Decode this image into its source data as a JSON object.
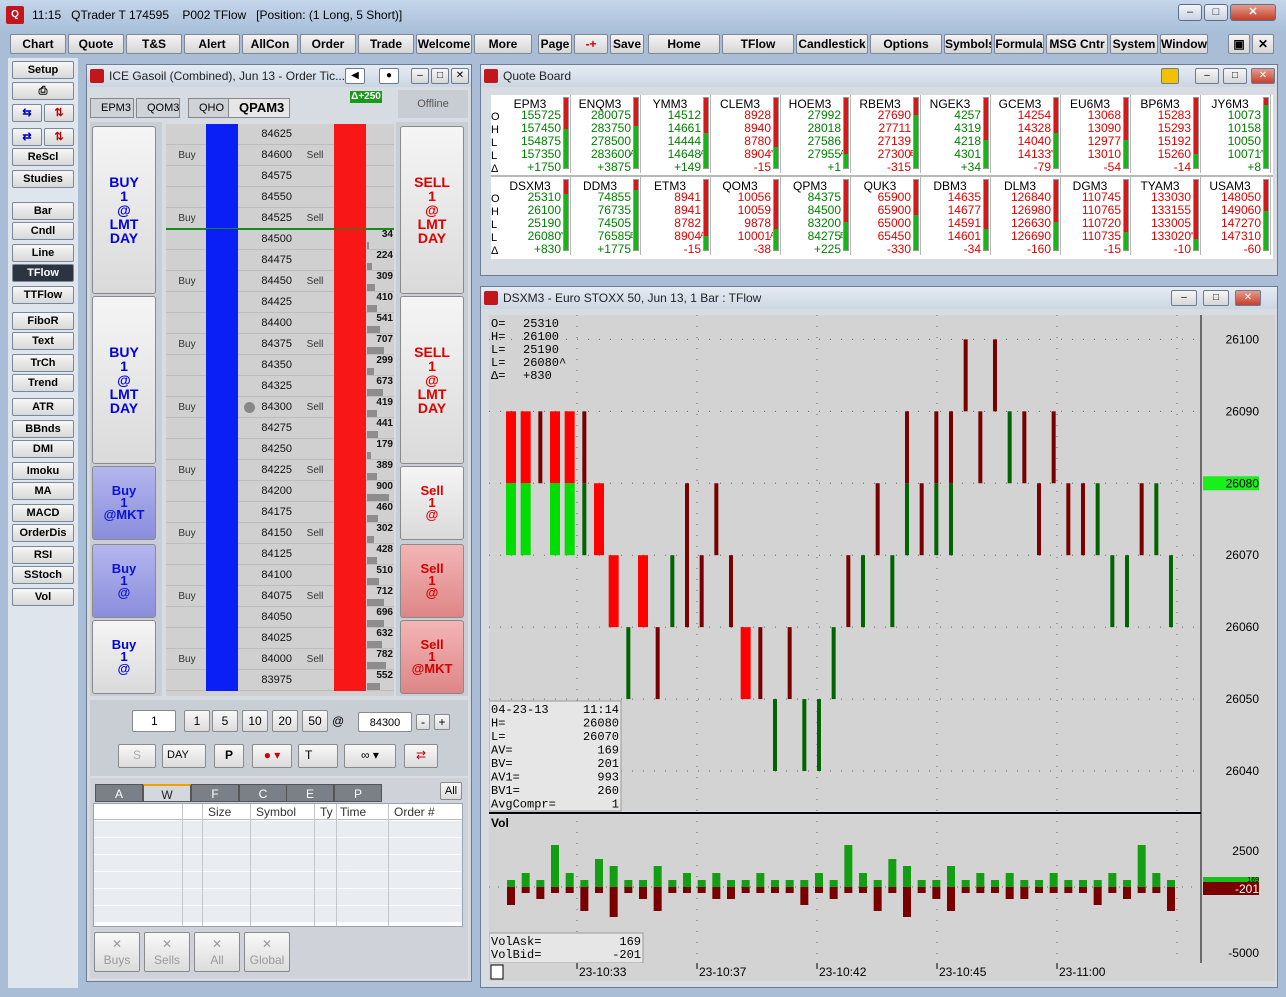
{
  "window": {
    "icon": "qtrader-logo",
    "time": "11:15",
    "title": "QTrader T 174595",
    "page": "P002 TFlow",
    "position": "[Position: (1 Long, 5 Short)]"
  },
  "toolbar": [
    "Chart",
    "Quote",
    "T&S",
    "Alert",
    "AllCon",
    "Order",
    "Trade",
    "Welcome",
    "More",
    "Page",
    "-+",
    "Save",
    "Home",
    "TFlow",
    "Candlestick",
    "Options",
    "Symbols",
    "Formula",
    "MSG Cntr",
    "System",
    "Window"
  ],
  "left_tools": [
    "Setup",
    "ReScl",
    "Studies",
    "Bar",
    "Cndl",
    "Line",
    "TFlow",
    "TTFlow",
    "FiboR",
    "Text",
    "TrCh",
    "Trend",
    "ATR",
    "BBnds",
    "DMI",
    "Imoku",
    "MA",
    "MACD",
    "OrderDis",
    "RSI",
    "SStoch",
    "Vol"
  ],
  "ticket": {
    "title": "ICE Gasoil (Combined), Jun 13 - Order Tic...",
    "tabs": [
      "EPM3",
      "QOM3",
      "QHO",
      "QPAM3"
    ],
    "delta": "Δ+250",
    "status": "Offline",
    "buy_buttons": [
      [
        "BUY",
        "1",
        "@",
        "LMT",
        "DAY"
      ],
      [
        "BUY",
        "1",
        "@",
        "LMT",
        "DAY"
      ],
      [
        "Buy",
        "1",
        "@MKT"
      ],
      [
        "Buy",
        "1",
        "@"
      ],
      [
        "Buy",
        "1",
        "@"
      ]
    ],
    "sell_buttons": [
      [
        "SELL",
        "1",
        "@",
        "LMT",
        "DAY"
      ],
      [
        "SELL",
        "1",
        "@",
        "LMT",
        "DAY"
      ],
      [
        "Sell",
        "1",
        "@"
      ],
      [
        "Sell",
        "1",
        "@"
      ],
      [
        "Sell",
        "1",
        "@MKT"
      ]
    ],
    "ladder": [
      {
        "price": "84625",
        "buy": "",
        "sell": "",
        "vol": ""
      },
      {
        "price": "84600",
        "buy": "Buy",
        "sell": "Sell",
        "vol": ""
      },
      {
        "price": "84575",
        "buy": "",
        "sell": "",
        "vol": ""
      },
      {
        "price": "84550",
        "buy": "",
        "sell": "",
        "vol": ""
      },
      {
        "price": "84525",
        "buy": "Buy",
        "sell": "Sell",
        "vol": ""
      },
      {
        "price": "84500",
        "buy": "",
        "sell": "",
        "vol": "34"
      },
      {
        "price": "84475",
        "buy": "",
        "sell": "",
        "vol": "224"
      },
      {
        "price": "84450",
        "buy": "Buy",
        "sell": "Sell",
        "vol": "309"
      },
      {
        "price": "84425",
        "buy": "",
        "sell": "",
        "vol": "410"
      },
      {
        "price": "84400",
        "buy": "",
        "sell": "",
        "vol": "541"
      },
      {
        "price": "84375",
        "buy": "Buy",
        "sell": "Sell",
        "vol": "707"
      },
      {
        "price": "84350",
        "buy": "",
        "sell": "",
        "vol": "299"
      },
      {
        "price": "84325",
        "buy": "",
        "sell": "",
        "vol": "673"
      },
      {
        "price": "84300",
        "buy": "Buy",
        "sell": "Sell",
        "vol": "419"
      },
      {
        "price": "84275",
        "buy": "",
        "sell": "",
        "vol": "441"
      },
      {
        "price": "84250",
        "buy": "",
        "sell": "",
        "vol": "179"
      },
      {
        "price": "84225",
        "buy": "Buy",
        "sell": "Sell",
        "vol": "389"
      },
      {
        "price": "84200",
        "buy": "",
        "sell": "",
        "vol": "900"
      },
      {
        "price": "84175",
        "buy": "",
        "sell": "",
        "vol": "460"
      },
      {
        "price": "84150",
        "buy": "Buy",
        "sell": "Sell",
        "vol": "302"
      },
      {
        "price": "84125",
        "buy": "",
        "sell": "",
        "vol": "428"
      },
      {
        "price": "84100",
        "buy": "",
        "sell": "",
        "vol": "510"
      },
      {
        "price": "84075",
        "buy": "Buy",
        "sell": "Sell",
        "vol": "712"
      },
      {
        "price": "84050",
        "buy": "",
        "sell": "",
        "vol": "696"
      },
      {
        "price": "84025",
        "buy": "",
        "sell": "",
        "vol": "632"
      },
      {
        "price": "84000",
        "buy": "Buy",
        "sell": "Sell",
        "vol": "782"
      },
      {
        "price": "83975",
        "buy": "",
        "sell": "",
        "vol": "552"
      }
    ],
    "qty": "1",
    "qty_presets": [
      "1",
      "5",
      "10",
      "20",
      "50"
    ],
    "at": "@",
    "price": "84300",
    "tif": "DAY",
    "type_t": "T",
    "grid_tabs": [
      "A",
      "W",
      "F",
      "C",
      "E",
      "P"
    ],
    "grid_all": "All",
    "grid_headers": [
      "Size",
      "Symbol",
      "Ty",
      "Time",
      "Order #"
    ],
    "cancel_buttons": [
      "Buys",
      "Sells",
      "All",
      "Global"
    ]
  },
  "quote_board": {
    "title": "Quote Board",
    "rows": [
      [
        {
          "sym": "EPM3",
          "o": "155725",
          "h": "157450",
          "l": "154875",
          "last": "157350",
          "d": "+1750",
          "color": "green",
          "tick": "",
          "fill": 0.55
        },
        {
          "sym": "ENQM3",
          "o": "280075",
          "h": "283750",
          "l": "278500",
          "last": "283600",
          "d": "+3875",
          "color": "green",
          "tick": "A",
          "fill": 0.6
        },
        {
          "sym": "YMM3",
          "o": "14512",
          "h": "14661",
          "l": "14444",
          "last": "14648",
          "d": "+149",
          "color": "green",
          "tick": "A",
          "fill": 0.5
        },
        {
          "sym": "CLEM3",
          "o": "8928",
          "h": "8940",
          "l": "8780",
          "last": "8904",
          "d": "-15",
          "color": "red",
          "tick": "^",
          "fill": 0.3
        },
        {
          "sym": "HOEM3",
          "o": "27992",
          "h": "28018",
          "l": "27586",
          "last": "27955",
          "d": "+1",
          "color": "green",
          "tick": "A",
          "fill": 0.2
        },
        {
          "sym": "RBEM3",
          "o": "27690",
          "h": "27711",
          "l": "27139",
          "last": "27300",
          "d": "-315",
          "color": "red",
          "tick": "B",
          "fill": 0.75
        },
        {
          "sym": "NGEK3",
          "o": "4257",
          "h": "4319",
          "l": "4218",
          "last": "4301",
          "d": "+34",
          "color": "green",
          "tick": "",
          "fill": 0.4
        },
        {
          "sym": "GCEM3",
          "o": "14254",
          "h": "14328",
          "l": "14040",
          "last": "14133",
          "d": "-79",
          "color": "red",
          "tick": "^",
          "fill": 0.5
        },
        {
          "sym": "EU6M3",
          "o": "13068",
          "h": "13090",
          "l": "12977",
          "last": "13010",
          "d": "-54",
          "color": "red",
          "tick": "",
          "fill": 0.4
        },
        {
          "sym": "BP6M3",
          "o": "15283",
          "h": "15293",
          "l": "15192",
          "last": "15260",
          "d": "-14",
          "color": "red",
          "tick": "",
          "fill": 0.2
        },
        {
          "sym": "JY6M3",
          "o": "10073",
          "h": "10158",
          "l": "10050",
          "last": "10071",
          "d": "+8",
          "color": "green",
          "tick": "^",
          "fill": 0.9
        }
      ],
      [
        {
          "sym": "DSXM3",
          "o": "25310",
          "h": "26100",
          "l": "25190",
          "last": "26080",
          "d": "+830",
          "color": "green",
          "tick": "^",
          "fill": 0.8
        },
        {
          "sym": "DDM3",
          "o": "74855",
          "h": "76735",
          "l": "74505",
          "last": "76585",
          "d": "+1775",
          "color": "green",
          "tick": "B",
          "fill": 0.85
        },
        {
          "sym": "ETM3",
          "o": "8941",
          "h": "8941",
          "l": "8782",
          "last": "8904",
          "d": "-15",
          "color": "red",
          "tick": "A",
          "fill": 0.2
        },
        {
          "sym": "QOM3",
          "o": "10056",
          "h": "10059",
          "l": "9878",
          "last": "10001",
          "d": "-38",
          "color": "red",
          "tick": "A",
          "fill": 0.3
        },
        {
          "sym": "QPM3",
          "o": "84375",
          "h": "84500",
          "l": "83200",
          "last": "84275",
          "d": "+225",
          "color": "green",
          "tick": "B",
          "fill": 0.4
        },
        {
          "sym": "QUK3",
          "o": "65900",
          "h": "65900",
          "l": "65000",
          "last": "65450",
          "d": "-330",
          "color": "red",
          "tick": "",
          "fill": 0.5
        },
        {
          "sym": "DBM3",
          "o": "14635",
          "h": "14677",
          "l": "14591",
          "last": "14601",
          "d": "-34",
          "color": "red",
          "tick": "",
          "fill": 0.3
        },
        {
          "sym": "DLM3",
          "o": "126840",
          "h": "126980",
          "l": "126630",
          "last": "126690",
          "d": "-160",
          "color": "red",
          "tick": "",
          "fill": 0.4
        },
        {
          "sym": "DGM3",
          "o": "110745",
          "h": "110765",
          "l": "110720",
          "last": "110735",
          "d": "-15",
          "color": "red",
          "tick": "",
          "fill": 0.25
        },
        {
          "sym": "TYAM3",
          "o": "133030",
          "h": "133155",
          "l": "133005",
          "last": "133020",
          "d": "-10",
          "color": "red",
          "tick": "^",
          "fill": 0.15
        },
        {
          "sym": "USAM3",
          "o": "148050",
          "h": "149060",
          "l": "147270",
          "last": "147310",
          "d": "-60",
          "color": "red",
          "tick": "",
          "fill": 0.55
        }
      ]
    ],
    "row_labels": [
      "O",
      "H",
      "L",
      "L",
      "Δ"
    ]
  },
  "chart": {
    "title": "DSXM3 - Euro STOXX 50, Jun 13, 1 Bar : TFlow",
    "ohlc_labels": [
      [
        "O=",
        "25310"
      ],
      [
        "H=",
        "26100"
      ],
      [
        "L=",
        "25190"
      ],
      [
        "L=",
        "26080^"
      ],
      [
        "Δ=",
        "+830"
      ]
    ],
    "info_box": [
      [
        "04-23-13",
        "11:14"
      ],
      [
        "H=",
        "26080"
      ],
      [
        "L=",
        "26070"
      ],
      [
        "AV=",
        "169"
      ],
      [
        "BV=",
        "201"
      ],
      [
        "AV1=",
        "993"
      ],
      [
        "BV1=",
        "260"
      ],
      [
        "AvgCompr=",
        "1"
      ]
    ],
    "price_axis": [
      "26100",
      "26090",
      "26080",
      "26070",
      "26060",
      "26050",
      "26040"
    ],
    "last_price": "26080",
    "vol_title": "Vol",
    "vol_axis": [
      "2500",
      "-5000"
    ],
    "vol_marker_top": "169",
    "vol_marker": "-201",
    "vol_labels": [
      [
        "VolAsk=",
        "169"
      ],
      [
        "VolBid=",
        "-201"
      ]
    ],
    "time_axis": [
      "23-10:33",
      "23-10:37",
      "23-10:42",
      "23-10:45",
      "23-11:00"
    ],
    "colors": {
      "up": "#00dd00",
      "down": "#ff0000",
      "up_thin": "#006400",
      "down_thin": "#7a0000"
    }
  },
  "chart_data": {
    "type": "bar",
    "title": "DSXM3 - Euro STOXX 50, Jun 13, 1 Bar : TFlow",
    "ylim": [
      26035,
      26102
    ],
    "bars": [
      {
        "hi": 26090,
        "lo": 26070,
        "split": 26080,
        "w": "wide"
      },
      {
        "hi": 26090,
        "lo": 26070,
        "split": 26080,
        "w": "wide"
      },
      {
        "hi": 26090,
        "lo": 26080,
        "split": 26080,
        "w": "thin"
      },
      {
        "hi": 26090,
        "lo": 26070,
        "split": 26080,
        "w": "wide"
      },
      {
        "hi": 26090,
        "lo": 26070,
        "split": 26080,
        "w": "wide"
      },
      {
        "hi": 26090,
        "lo": 26070,
        "split": 26080,
        "w": "thin"
      },
      {
        "hi": 26080,
        "lo": 26070,
        "split": 26070,
        "w": "wide"
      },
      {
        "hi": 26070,
        "lo": 26060,
        "split": 26060,
        "w": "wide"
      },
      {
        "hi": 26060,
        "lo": 26050,
        "split": 26060,
        "w": "thin"
      },
      {
        "hi": 26070,
        "lo": 26060,
        "split": 26060,
        "w": "wide"
      },
      {
        "hi": 26060,
        "lo": 26050,
        "split": 26050,
        "w": "thin"
      },
      {
        "hi": 26070,
        "lo": 26060,
        "split": 26070,
        "w": "thin"
      },
      {
        "hi": 26080,
        "lo": 26060,
        "split": 26060,
        "w": "thin"
      },
      {
        "hi": 26070,
        "lo": 26060,
        "split": 26060,
        "w": "thin"
      },
      {
        "hi": 26080,
        "lo": 26070,
        "split": 26070,
        "w": "thin"
      },
      {
        "hi": 26070,
        "lo": 26060,
        "split": 26060,
        "w": "thin"
      },
      {
        "hi": 26060,
        "lo": 26050,
        "split": 26050,
        "w": "wide"
      },
      {
        "hi": 26060,
        "lo": 26050,
        "split": 26050,
        "w": "thin"
      },
      {
        "hi": 26050,
        "lo": 26040,
        "split": 26050,
        "w": "thin"
      },
      {
        "hi": 26060,
        "lo": 26050,
        "split": 26050,
        "w": "thin"
      },
      {
        "hi": 26050,
        "lo": 26040,
        "split": 26050,
        "w": "thin"
      },
      {
        "hi": 26050,
        "lo": 26040,
        "split": 26050,
        "w": "thin"
      },
      {
        "hi": 26060,
        "lo": 26050,
        "split": 26060,
        "w": "thin"
      },
      {
        "hi": 26070,
        "lo": 26060,
        "split": 26060,
        "w": "thin"
      },
      {
        "hi": 26070,
        "lo": 26060,
        "split": 26070,
        "w": "thin"
      },
      {
        "hi": 26080,
        "lo": 26070,
        "split": 26070,
        "w": "thin"
      },
      {
        "hi": 26070,
        "lo": 26060,
        "split": 26070,
        "w": "thin"
      },
      {
        "hi": 26090,
        "lo": 26070,
        "split": 26080,
        "w": "thin"
      },
      {
        "hi": 26080,
        "lo": 26070,
        "split": 26070,
        "w": "thin"
      },
      {
        "hi": 26090,
        "lo": 26070,
        "split": 26080,
        "w": "thin"
      },
      {
        "hi": 26090,
        "lo": 26070,
        "split": 26080,
        "w": "thin"
      },
      {
        "hi": 26100,
        "lo": 26090,
        "split": 26090,
        "w": "thin"
      },
      {
        "hi": 26090,
        "lo": 26080,
        "split": 26080,
        "w": "thin"
      },
      {
        "hi": 26100,
        "lo": 26090,
        "split": 26090,
        "w": "thin"
      },
      {
        "hi": 26090,
        "lo": 26080,
        "split": 26090,
        "w": "thin"
      },
      {
        "hi": 26090,
        "lo": 26080,
        "split": 26080,
        "w": "thin"
      },
      {
        "hi": 26080,
        "lo": 26070,
        "split": 26070,
        "w": "thin"
      },
      {
        "hi": 26090,
        "lo": 26080,
        "split": 26080,
        "w": "thin"
      },
      {
        "hi": 26080,
        "lo": 26070,
        "split": 26070,
        "w": "thin"
      },
      {
        "hi": 26080,
        "lo": 26070,
        "split": 26070,
        "w": "thin"
      },
      {
        "hi": 26080,
        "lo": 26070,
        "split": 26080,
        "w": "thin"
      },
      {
        "hi": 26070,
        "lo": 26060,
        "split": 26070,
        "w": "thin"
      },
      {
        "hi": 26070,
        "lo": 26060,
        "split": 26070,
        "w": "thin"
      },
      {
        "hi": 26080,
        "lo": 26070,
        "split": 26070,
        "w": "thin"
      },
      {
        "hi": 26080,
        "lo": 26070,
        "split": 26080,
        "w": "thin"
      },
      {
        "hi": 26070,
        "lo": 26060,
        "split": 26070,
        "w": "thin"
      }
    ],
    "volume": [
      {
        "up": 1,
        "dn": 3
      },
      {
        "up": 2,
        "dn": 1
      },
      {
        "up": 1,
        "dn": 2
      },
      {
        "up": 6,
        "dn": 1
      },
      {
        "up": 2,
        "dn": 1
      },
      {
        "up": 1,
        "dn": 4
      },
      {
        "up": 4,
        "dn": 1
      },
      {
        "up": 3,
        "dn": 5
      },
      {
        "up": 1,
        "dn": 1
      },
      {
        "up": 1,
        "dn": 2
      },
      {
        "up": 3,
        "dn": 4
      },
      {
        "up": 1,
        "dn": 1
      },
      {
        "up": 2,
        "dn": 1
      },
      {
        "up": 1,
        "dn": 1
      },
      {
        "up": 2,
        "dn": 2
      },
      {
        "up": 1,
        "dn": 2
      },
      {
        "up": 1,
        "dn": 1
      },
      {
        "up": 2,
        "dn": 1
      },
      {
        "up": 1,
        "dn": 1
      },
      {
        "up": 1,
        "dn": 1
      }
    ]
  }
}
